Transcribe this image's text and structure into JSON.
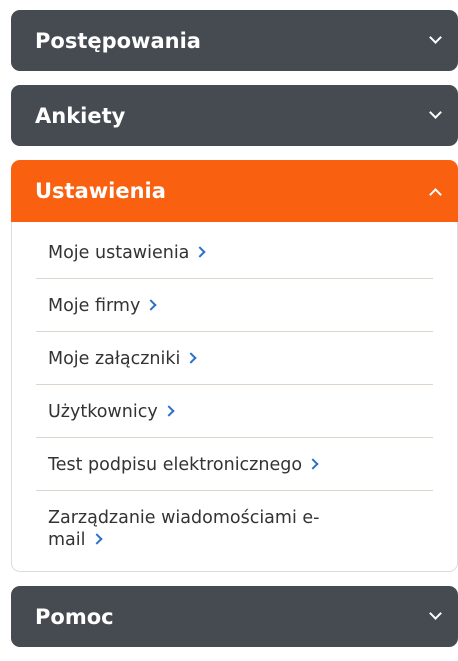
{
  "menu": {
    "postepowania": {
      "label": "Postępowania"
    },
    "ankiety": {
      "label": "Ankiety"
    },
    "ustawienia": {
      "label": "Ustawienia",
      "items": [
        {
          "label": "Moje ustawienia"
        },
        {
          "label": "Moje firmy"
        },
        {
          "label": "Moje załączniki"
        },
        {
          "label": "Użytkownicy"
        },
        {
          "label": "Test podpisu elektronicznego"
        },
        {
          "label": "Zarządzanie wiadomościami e-mail"
        }
      ]
    },
    "pomoc": {
      "label": "Pomoc"
    }
  },
  "icons": {
    "collapsed": "chevron-down-icon",
    "expanded": "chevron-up-icon",
    "link": "chevron-right-icon"
  },
  "colors": {
    "header_bg": "#454b51",
    "active_header_bg": "#f9600f",
    "link_arrow": "#2a70c9"
  }
}
